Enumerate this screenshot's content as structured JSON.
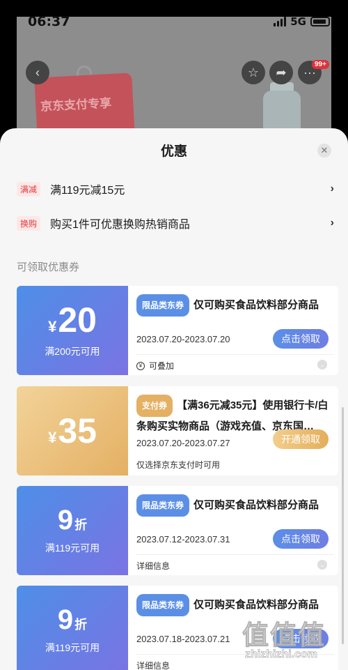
{
  "status": {
    "time": "06:37",
    "network": "5G"
  },
  "product": {
    "tag_text": "京东支付专享",
    "cart_badge": "99+"
  },
  "sheet": {
    "title": "优惠"
  },
  "promos": [
    {
      "tag": "满减",
      "text": "满119元减15元"
    },
    {
      "tag": "换购",
      "text": "购买1件可优惠换购热销商品"
    }
  ],
  "section_label": "可领取优惠券",
  "coupons": [
    {
      "amount": "20",
      "currency": "¥",
      "suffix": "",
      "condition": "满200元可用",
      "type": "限品类东券",
      "title": "仅可购买食品饮料部分商品",
      "period": "2023.07.20-2023.07.20",
      "button": "点击领取",
      "footer": "可叠加",
      "color": "blue"
    },
    {
      "amount": "35",
      "currency": "¥",
      "suffix": "",
      "condition": "",
      "type": "支付券",
      "title": "【满36元减35元】使用银行卡/白条购买实物商品（游戏充值、京东国…",
      "period": "2023.07.20-2023.07.27",
      "button": "开通领取",
      "footer": "仅选择京东支付时可用",
      "color": "gold"
    },
    {
      "amount": "9",
      "currency": "",
      "suffix": "折",
      "condition": "满119元可用",
      "type": "限品类东券",
      "title": "仅可购买食品饮料部分商品",
      "period": "2023.07.12-2023.07.31",
      "button": "点击领取",
      "footer": "详细信息",
      "color": "blue"
    },
    {
      "amount": "9",
      "currency": "",
      "suffix": "折",
      "condition": "满119元可用",
      "type": "限品类东券",
      "title": "仅可购买食品饮料部分商品",
      "period": "2023.07.18-2023.07.21",
      "button": "点击领取",
      "footer": "详细信息",
      "color": "blue"
    }
  ],
  "watermark": {
    "logo": "值值值",
    "url": "zhizhizhi.com"
  }
}
